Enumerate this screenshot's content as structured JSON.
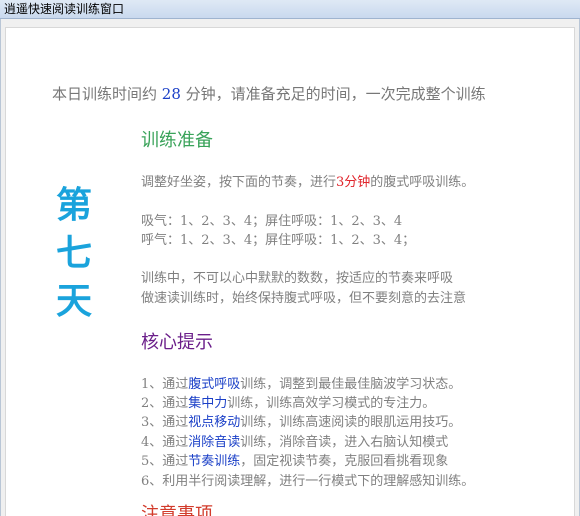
{
  "window": {
    "title": "逍遥快速阅读训练窗口"
  },
  "intro": {
    "prefix": "本日训练时间约 ",
    "minutes": "28",
    "suffix": " 分钟，请准备充足的时间，一次完成整个训练"
  },
  "day_chars": [
    "第",
    "七",
    "天"
  ],
  "prep": {
    "title": "训练准备",
    "line1_prefix": "调整好坐姿，按下面的节奏，进行",
    "line1_highlight": "3分钟",
    "line1_suffix": "的腹式呼吸训练。",
    "inhale": "吸气：1、2、3、4；屏住呼吸：1、2、3、4",
    "exhale": "呼气：1、2、3、4；屏住呼吸：1、2、3、4；",
    "note1": "训练中，不可以心中默默的数数，按适应的节奏来呼吸",
    "note2": "做速读训练时，始终保持腹式呼吸，但不要刻意的去注意"
  },
  "core": {
    "title": "核心提示",
    "items": [
      {
        "prefix": "1、通过",
        "highlight": "腹式呼吸",
        "suffix": "训练，调整到最佳最佳脑波学习状态。"
      },
      {
        "prefix": "2、通过",
        "highlight": "集中力",
        "suffix": "训练，训练高效学习模式的专注力。"
      },
      {
        "prefix": "3、通过",
        "highlight": "视点移动",
        "suffix": "训练，训练高速阅读的眼肌运用技巧。"
      },
      {
        "prefix": "4、通过",
        "highlight": "消除音读",
        "suffix": "训练，消除音读，进入右脑认知模式"
      },
      {
        "prefix": "5、通过",
        "highlight": "节奏训练",
        "suffix": "，固定视读节奏，克服回看挑看现象"
      },
      {
        "prefix": "6、利用半行阅读理解，进行一行模式下的理解感知训练。",
        "highlight": "",
        "suffix": ""
      }
    ]
  },
  "notice": {
    "title": "注意事项"
  },
  "colors": {
    "accent_blue": "#1a3fc7",
    "accent_red": "#e0242b",
    "day_blue": "#1aa3dc",
    "green_title": "#3aa35a",
    "purple_title": "#6b1f8a"
  }
}
